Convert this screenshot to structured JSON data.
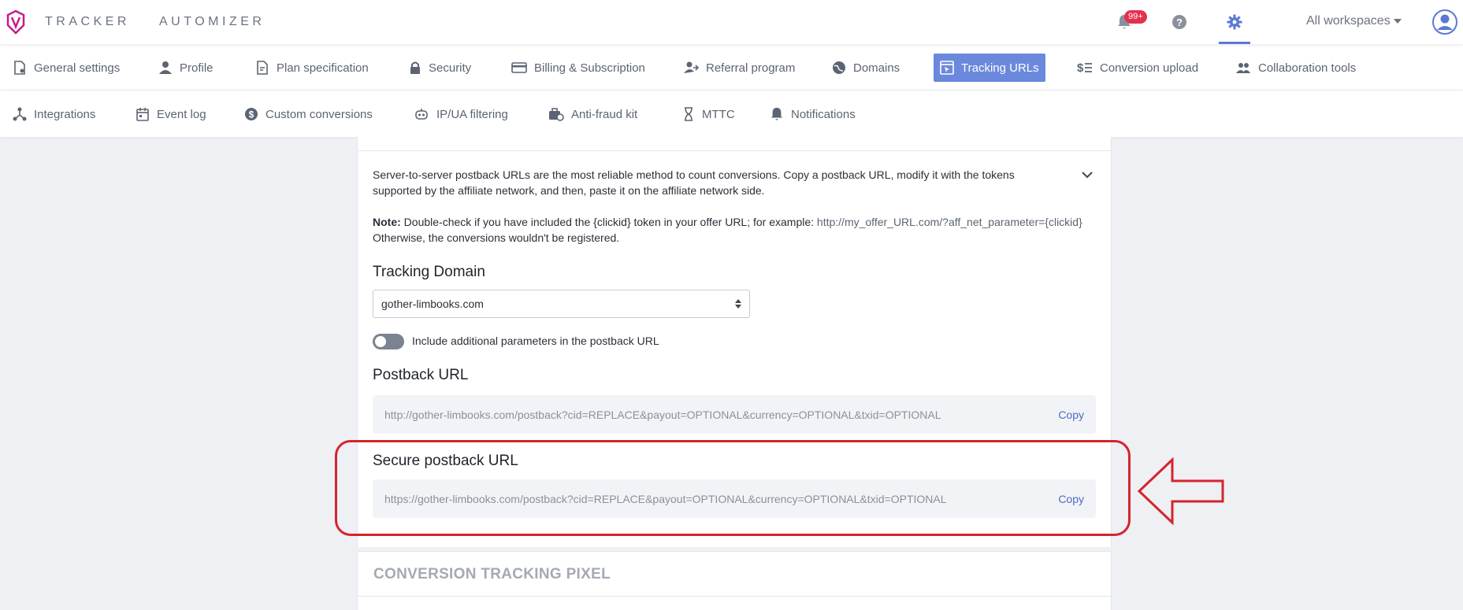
{
  "topbar": {
    "brand_left": "TRACKER",
    "brand_right": "AUTOMIZER",
    "notifications_badge": "99+",
    "workspaces_label": "All workspaces"
  },
  "nav_row1": [
    {
      "label": "General settings",
      "icon": "settings-doc-icon"
    },
    {
      "label": "Profile",
      "icon": "person-icon"
    },
    {
      "label": "Plan specification",
      "icon": "plan-doc-icon"
    },
    {
      "label": "Security",
      "icon": "lock-icon"
    },
    {
      "label": "Billing & Subscription",
      "icon": "credit-card-icon"
    },
    {
      "label": "Referral program",
      "icon": "referral-icon"
    },
    {
      "label": "Domains",
      "icon": "globe-icon"
    },
    {
      "label": "Tracking URLs",
      "icon": "tracking-icon",
      "active": true
    },
    {
      "label": "Conversion upload",
      "icon": "dollar-list-icon"
    },
    {
      "label": "Collaboration tools",
      "icon": "people-icon"
    }
  ],
  "nav_row2": [
    {
      "label": "Integrations",
      "icon": "integrations-icon"
    },
    {
      "label": "Event log",
      "icon": "calendar-icon"
    },
    {
      "label": "Custom conversions",
      "icon": "dollar-circle-icon"
    },
    {
      "label": "IP/UA filtering",
      "icon": "robot-icon"
    },
    {
      "label": "Anti-fraud kit",
      "icon": "fraud-kit-icon"
    },
    {
      "label": "MTTC",
      "icon": "hourglass-icon"
    },
    {
      "label": "Notifications",
      "icon": "bell-icon"
    }
  ],
  "content": {
    "description": "Server-to-server postback URLs are the most reliable method to count conversions. Copy a postback URL, modify it with the tokens supported by the affiliate network, and then, paste it on the affiliate network side.",
    "note_label": "Note:",
    "note_text_1": " Double-check if you have included the {clickid} token in your offer URL; for example:  ",
    "note_example": "http://my_offer_URL.com/?aff_net_parameter={clickid}",
    "note_text_2": "  Otherwise, the conversions wouldn't be registered.",
    "tracking_domain_label": "Tracking Domain",
    "tracking_domain_value": "gother-limbooks.com",
    "toggle_label": "Include additional parameters in the postback URL",
    "toggle_on": false,
    "postback_label": "Postback URL",
    "postback_url": "http://gother-limbooks.com/postback?cid=REPLACE&payout=OPTIONAL&currency=OPTIONAL&txid=OPTIONAL",
    "secure_postback_label": "Secure postback URL",
    "secure_postback_url": "https://gother-limbooks.com/postback?cid=REPLACE&payout=OPTIONAL&currency=OPTIONAL&txid=OPTIONAL",
    "copy_label": "Copy",
    "section2_title": "CONVERSION TRACKING PIXEL"
  },
  "colors": {
    "accent": "#6b89dc",
    "highlight": "#d4242c",
    "badge": "#e5304c",
    "link": "#4c6bc8"
  }
}
